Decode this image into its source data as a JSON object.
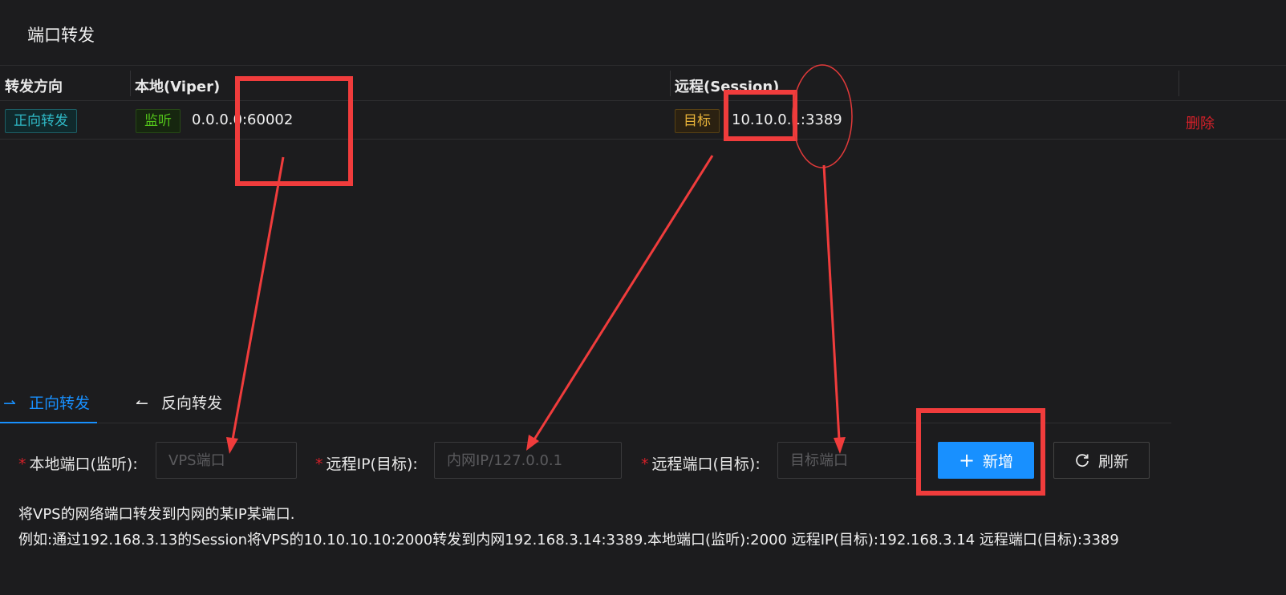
{
  "header": {
    "title": "端口转发"
  },
  "table": {
    "columns": [
      "转发方向",
      "本地(Viper)",
      "远程(Session)"
    ],
    "rows": [
      {
        "direction": "正向转发",
        "local_tag": "监听",
        "local_addr": "0.0.0.0:60002",
        "remote_tag": "目标",
        "remote_addr": "10.10.0.1:3389",
        "action": "删除"
      }
    ]
  },
  "tabs": {
    "forward": {
      "icon": "arrow-right-icon",
      "label": "正向转发"
    },
    "reverse": {
      "icon": "arrow-left-icon",
      "label": "反向转发"
    }
  },
  "form": {
    "local_port": {
      "label": "本地端口(监听):",
      "placeholder": "VPS端口",
      "value": ""
    },
    "remote_ip": {
      "label": "远程IP(目标):",
      "placeholder": "内网IP/127.0.0.1",
      "value": ""
    },
    "remote_port": {
      "label": "远程端口(目标):",
      "placeholder": "目标端口",
      "value": ""
    },
    "add_button": "新增",
    "refresh_button": "刷新"
  },
  "description": {
    "line1": "将VPS的网络端口转发到内网的某IP某端口.",
    "line2": "例如:通过192.168.3.13的Session将VPS的10.10.10.10:2000转发到内网192.168.3.14:3389.本地端口(监听):2000 远程IP(目标):192.168.3.14 远程端口(目标):3389"
  },
  "colors": {
    "background": "#1c1c1e",
    "primary": "#1890ff",
    "danger": "#d32029",
    "annotation": "#f03c3c"
  }
}
